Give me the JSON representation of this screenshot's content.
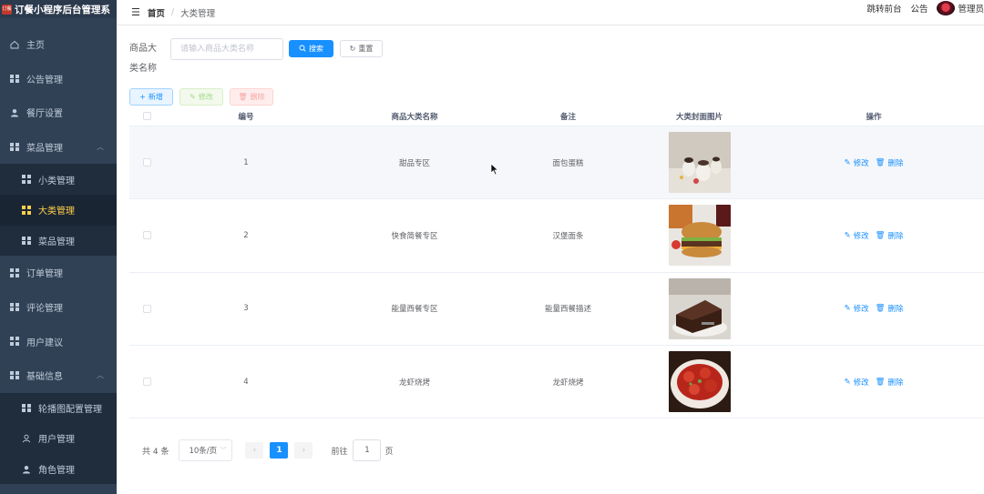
{
  "app": {
    "logo_badge": "订餐",
    "title": "订餐小程序后台管理系"
  },
  "sidebar": {
    "items": [
      {
        "label": "主页",
        "icon": "home-icon"
      },
      {
        "label": "公告管理",
        "icon": "grid-icon"
      },
      {
        "label": "餐厅设置",
        "icon": "user-icon"
      },
      {
        "label": "菜品管理",
        "icon": "grid-icon",
        "expanded": true
      },
      {
        "label": "小类管理",
        "icon": "grid-icon"
      },
      {
        "label": "大类管理",
        "icon": "grid-icon",
        "active": true
      },
      {
        "label": "菜品管理",
        "icon": "grid-icon"
      },
      {
        "label": "订单管理",
        "icon": "grid-icon"
      },
      {
        "label": "评论管理",
        "icon": "grid-icon"
      },
      {
        "label": "用户建议",
        "icon": "grid-icon"
      },
      {
        "label": "基础信息",
        "icon": "grid-icon",
        "expanded": true
      },
      {
        "label": "轮播图配置管理",
        "icon": "grid-icon"
      },
      {
        "label": "用户管理",
        "icon": "person-outline-icon"
      },
      {
        "label": "角色管理",
        "icon": "user-icon"
      }
    ]
  },
  "header": {
    "breadcrumb_home": "首页",
    "breadcrumb_sep": "/",
    "breadcrumb_current": "大类管理",
    "link_frontend": "跳转前台",
    "link_notice": "公告",
    "user": "管理员"
  },
  "search": {
    "label": "商品大类名称",
    "placeholder": "请输入商品大类名称",
    "search_btn": "搜索",
    "reset_btn": "重置"
  },
  "toolbar": {
    "add": "新增",
    "edit": "修改",
    "delete": "删除"
  },
  "table": {
    "headers": [
      "编号",
      "商品大类名称",
      "备注",
      "大类封面图片",
      "操作"
    ],
    "rows": [
      {
        "id": "1",
        "name": "甜品专区",
        "note": "面包蛋糕",
        "image": "dessert"
      },
      {
        "id": "2",
        "name": "快食简餐专区",
        "note": "汉堡面条",
        "image": "burger"
      },
      {
        "id": "3",
        "name": "能量西餐专区",
        "note": "能量西餐描述",
        "image": "cake"
      },
      {
        "id": "4",
        "name": "龙虾烧烤",
        "note": "龙虾烧烤",
        "image": "crayfish"
      }
    ],
    "op_edit": "修改",
    "op_delete": "删除"
  },
  "pagination": {
    "total": "共 4 条",
    "page_size": "10条/页",
    "current_page": "1",
    "goto_prefix": "前往",
    "goto_value": "1",
    "goto_suffix": "页"
  },
  "colors": {
    "sidebar_bg": "#304156",
    "primary": "#1890ff",
    "active_menu": "#ffd04b"
  }
}
